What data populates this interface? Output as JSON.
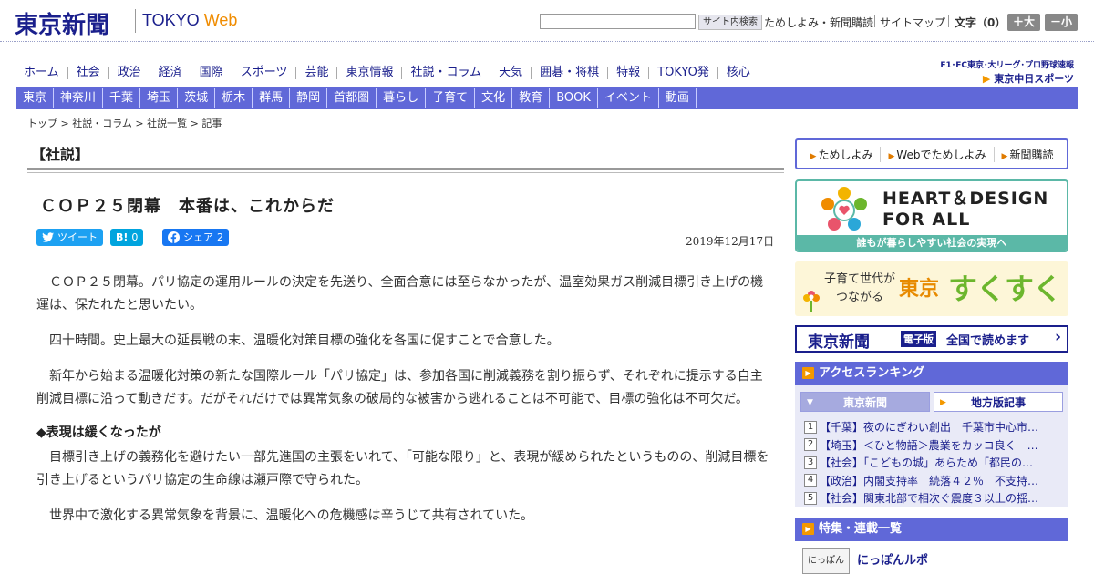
{
  "header": {
    "logo": "東京新聞",
    "logo_tokyo": "TOKYO ",
    "logo_web": "Web",
    "search_placeholder": "",
    "search_button": "サイト内検索",
    "link_trial": "ためしよみ・新聞購読",
    "link_sitemap": "サイトマップ",
    "text_size_label": "文字（0）",
    "size_up": "＋大",
    "size_down": "－小"
  },
  "nav_main": [
    "ホーム",
    "社会",
    "政治",
    "経済",
    "国際",
    "スポーツ",
    "芸能",
    "東京情報",
    "社説・コラム",
    "天気",
    "囲碁・将棋",
    "特報",
    "TOKYO発",
    "核心"
  ],
  "nav_region": [
    "東京",
    "神奈川",
    "千葉",
    "埼玉",
    "茨城",
    "栃木",
    "群馬",
    "静岡",
    "首都圏",
    "暮らし",
    "子育て",
    "文化",
    "教育",
    "BOOK",
    "イベント",
    "動画"
  ],
  "chunichi": {
    "top": "F1･FC東京･大リーグ･プロ野球速報",
    "logo": "東京中日スポーツ"
  },
  "breadcrumb": [
    "トップ",
    "社説・コラム",
    "社説一覧",
    "記事"
  ],
  "article": {
    "section": "【社説】",
    "headline": "ＣＯＰ２５閉幕　本番は、これからだ",
    "date": "2019年12月17日",
    "share": {
      "tweet": "ツイート",
      "hatena_icon": "B!",
      "hatena_count": "0",
      "facebook_label": "シェア",
      "facebook_count": "2"
    },
    "paragraphs": [
      "ＣＯＰ２５閉幕。パリ協定の運用ルールの決定を先送り、全面合意には至らなかったが、温室効果ガス削減目標引き上げの機運は、保たれたと思いたい。",
      "四十時間。史上最大の延長戦の末、温暖化対策目標の強化を各国に促すことで合意した。",
      "新年から始まる温暖化対策の新たな国際ルール「パリ協定」は、参加各国に削減義務を割り振らず、それぞれに提示する自主削減目標に沿って動きだす。だがそれだけでは異常気象の破局的な被害から逃れることは不可能で、目標の強化は不可欠だ。"
    ],
    "subheading": "◆表現は緩くなったが",
    "paragraphs2": [
      "目標引き上げの義務化を避けたい一部先進国の主張をいれて、「可能な限り」と、表現が緩められたというものの、削減目標を引き上げるというパリ協定の生命線は瀬戸際で守られた。",
      "世界中で激化する異常気象を背景に、温暖化への危機感は辛うじて共有されていた。"
    ]
  },
  "sidebar": {
    "subscribe": [
      "ためしよみ",
      "Webでためしよみ",
      "新聞購読"
    ],
    "hd_banner_title_1": "HEART＆DESIGN",
    "hd_banner_title_2": "FOR ALL",
    "hd_banner_sub": "誰もが暮らしやすい社会の実現へ",
    "sk_line1": "子育て世代が",
    "sk_line2": "つながる",
    "sk_title": "東京",
    "sk_title2": "すくすく",
    "ep_logo": "東京新聞",
    "ep_tag": "電子版",
    "ep_text": "全国で読めます",
    "ranking_title": "アクセスランキング",
    "ranking_tab1": "東京新聞",
    "ranking_tab2": "地方版記事",
    "ranking": [
      {
        "num": "1",
        "text": "【千葉】夜のにぎわい創出　千葉市中心市…"
      },
      {
        "num": "2",
        "text": "【埼玉】＜ひと物語＞農業をカッコ良く　…"
      },
      {
        "num": "3",
        "text": "【社会】「こどもの城」あらため「都民の…"
      },
      {
        "num": "4",
        "text": "【政治】内閣支持率　続落４２％　不支持…"
      },
      {
        "num": "5",
        "text": "【社会】関東北部で相次ぐ震度３以上の揺…"
      }
    ],
    "features_title": "特集・連載一覧",
    "feature_thumb": "にっぽん",
    "feature_title": "にっぽんルポ"
  },
  "colors": {
    "brand_navy": "#1a1f8c",
    "nav_purple": "#6068d8",
    "accent_orange": "#f39800",
    "hd_teal": "#5bb8a7"
  }
}
